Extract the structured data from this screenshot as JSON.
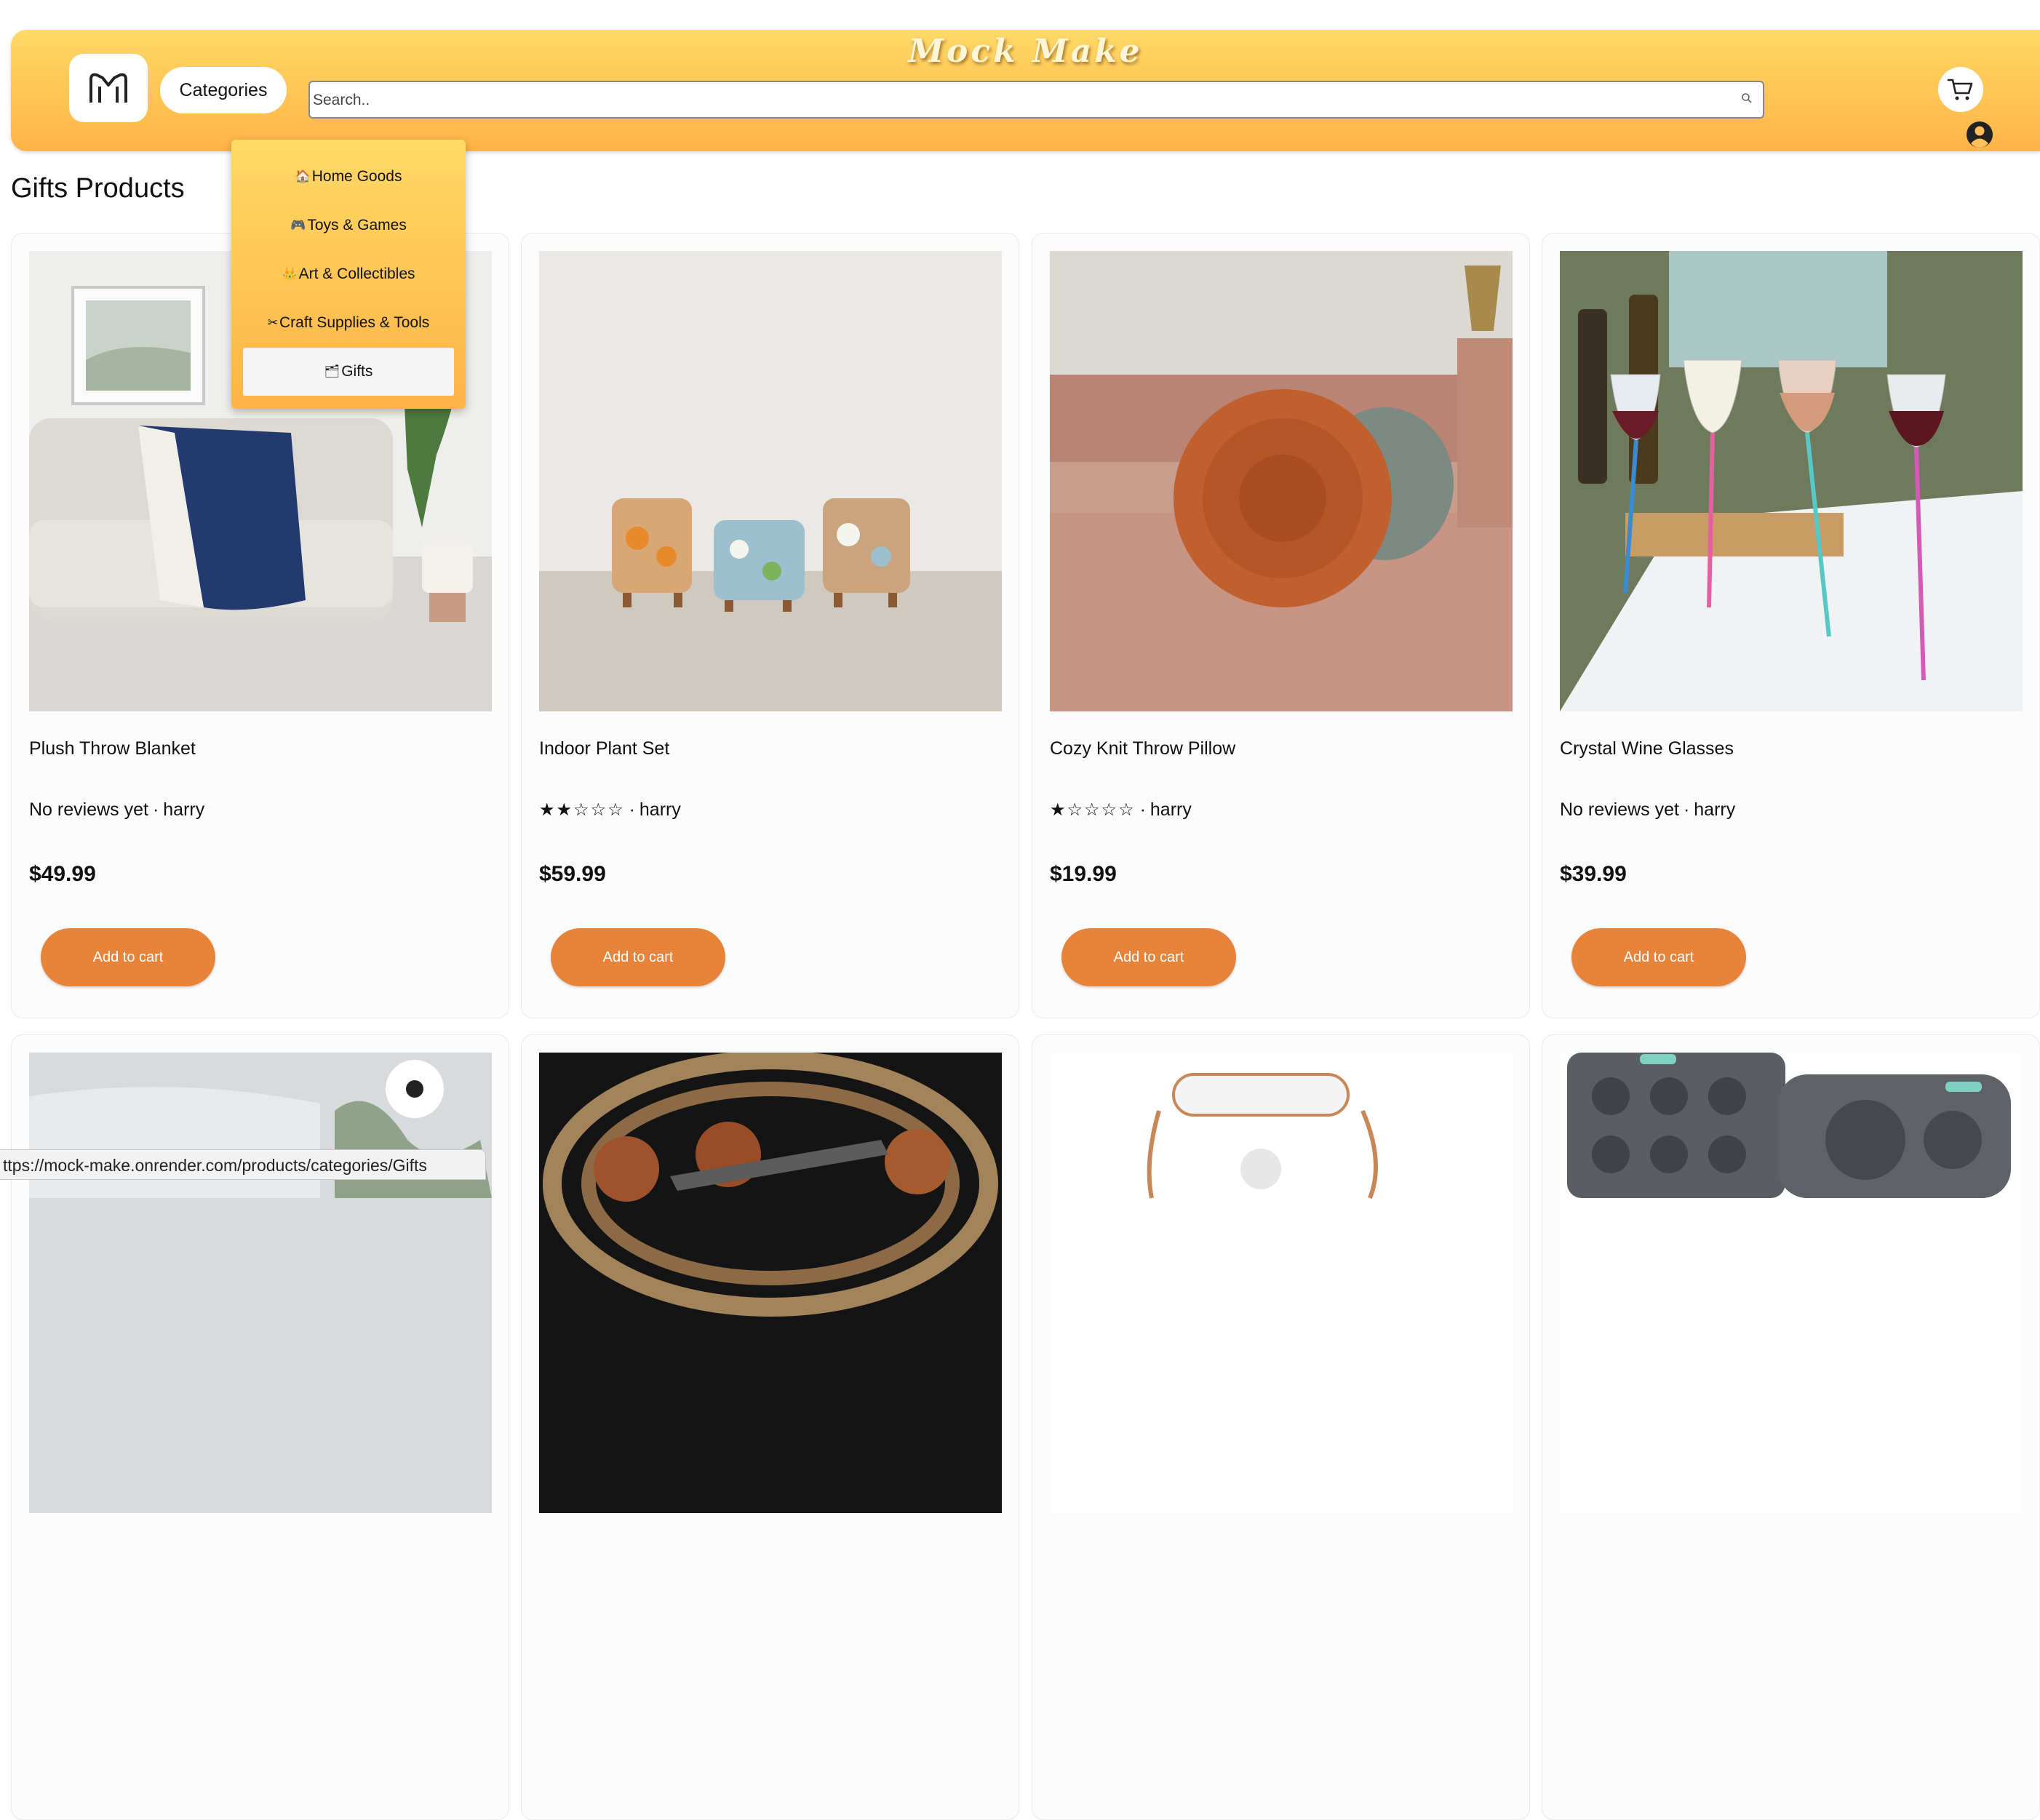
{
  "header": {
    "brand": "Mock Make",
    "categories_label": "Categories",
    "search_placeholder": "Search.."
  },
  "page": {
    "title": "Gifts Products"
  },
  "dropdown": {
    "items": [
      {
        "icon": "🏠",
        "label": "Home Goods"
      },
      {
        "icon": "🎮",
        "label": "Toys & Games"
      },
      {
        "icon": "👑",
        "label": "Art & Collectibles"
      },
      {
        "icon": "✂",
        "label": "Craft Supplies & Tools"
      },
      {
        "icon": "🗂",
        "label": "Gifts",
        "active": true
      }
    ]
  },
  "products": [
    {
      "name": "Plush Throw Blanket",
      "rating_text": "No reviews yet",
      "stars": "",
      "seller": "harry",
      "price": "$49.99",
      "cta": "Add to cart"
    },
    {
      "name": "Indoor Plant Set",
      "rating_text": "",
      "stars": "★★☆☆☆",
      "seller": "harry",
      "price": "$59.99",
      "cta": "Add to cart"
    },
    {
      "name": "Cozy Knit Throw Pillow",
      "rating_text": "",
      "stars": "★☆☆☆☆",
      "seller": "harry",
      "price": "$19.99",
      "cta": "Add to cart"
    },
    {
      "name": "Crystal Wine Glasses",
      "rating_text": "No reviews yet",
      "stars": "",
      "seller": "harry",
      "price": "$39.99",
      "cta": "Add to cart"
    }
  ],
  "rating_separator": "·",
  "status_url": "ttps://mock-make.onrender.com/products/categories/Gifts"
}
